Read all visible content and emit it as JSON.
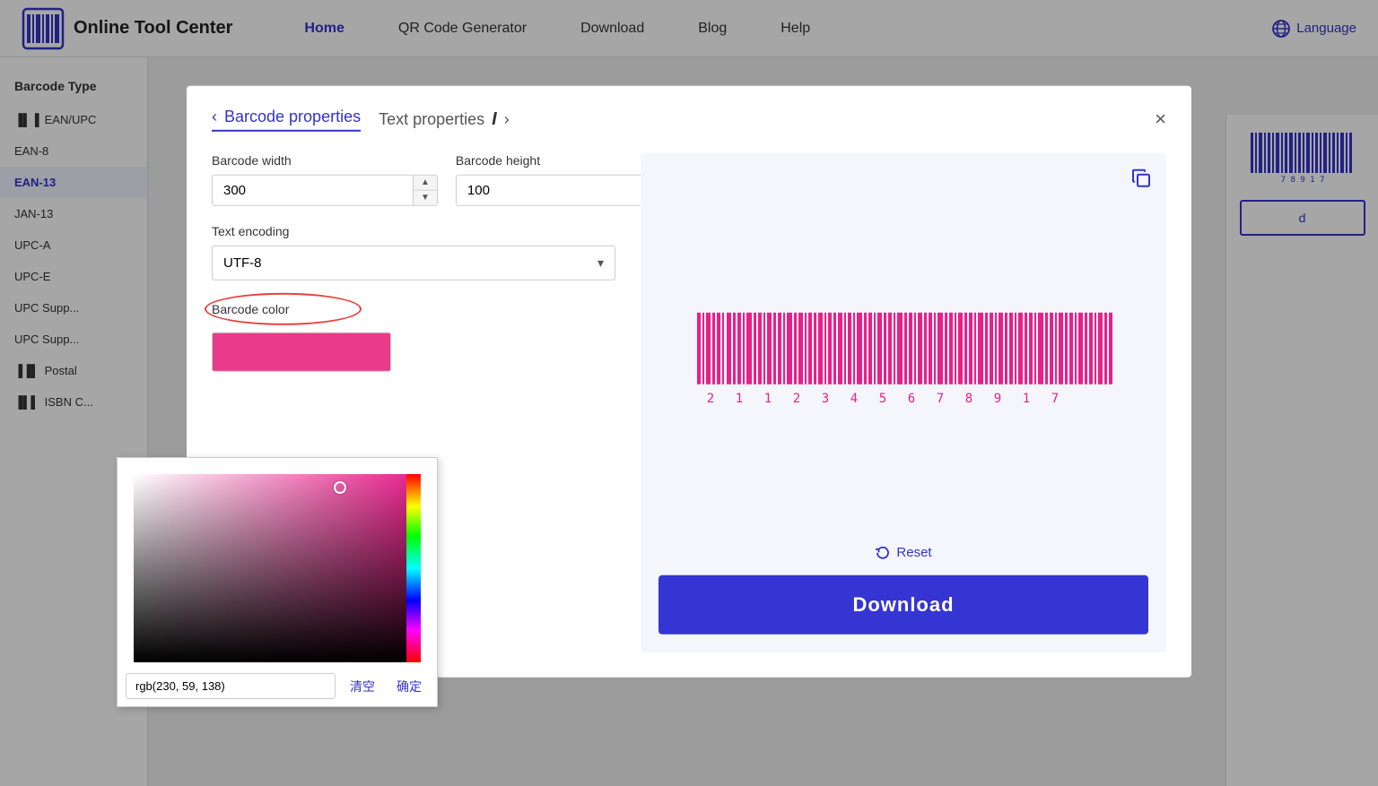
{
  "header": {
    "logo_text": "Online Tool Center",
    "nav_items": [
      {
        "label": "Home",
        "active": true
      },
      {
        "label": "QR Code Generator",
        "active": false
      },
      {
        "label": "Download",
        "active": false
      },
      {
        "label": "Blog",
        "active": false
      },
      {
        "label": "Help",
        "active": false
      }
    ],
    "language_label": "Language"
  },
  "sidebar": {
    "title": "Barcode Type",
    "items": [
      {
        "label": "EAN/UPC",
        "icon": true,
        "active": false
      },
      {
        "label": "EAN-8",
        "active": false
      },
      {
        "label": "EAN-13",
        "active": true
      },
      {
        "label": "JAN-13",
        "active": false
      },
      {
        "label": "UPC-A",
        "active": false
      },
      {
        "label": "UPC-E",
        "active": false
      },
      {
        "label": "UPC Supp...",
        "active": false
      },
      {
        "label": "UPC Supp...",
        "active": false
      },
      {
        "label": "Postal",
        "icon": true,
        "active": false
      },
      {
        "label": "ISBN C...",
        "icon": true,
        "active": false
      }
    ]
  },
  "modal": {
    "tab_barcode_props": "Barcode properties",
    "tab_text_props": "Text properties",
    "close_label": "×",
    "barcode_width_label": "Barcode width",
    "barcode_width_value": "300",
    "barcode_height_label": "Barcode height",
    "barcode_height_value": "100",
    "text_encoding_label": "Text encoding",
    "text_encoding_value": "UTF-8",
    "barcode_color_label": "Barcode color",
    "barcode_color_swatch": "#e83b8a",
    "color_picker_value": "rgb(230, 59, 138)",
    "color_picker_clear": "清空",
    "color_picker_confirm": "确定",
    "reset_label": "Reset",
    "download_label": "Download"
  },
  "barcode": {
    "digits": [
      "2",
      "1",
      "1",
      "2",
      "3",
      "4",
      "5",
      "6",
      "7",
      "8",
      "9",
      "1",
      "7"
    ],
    "color": "#e8208a"
  }
}
